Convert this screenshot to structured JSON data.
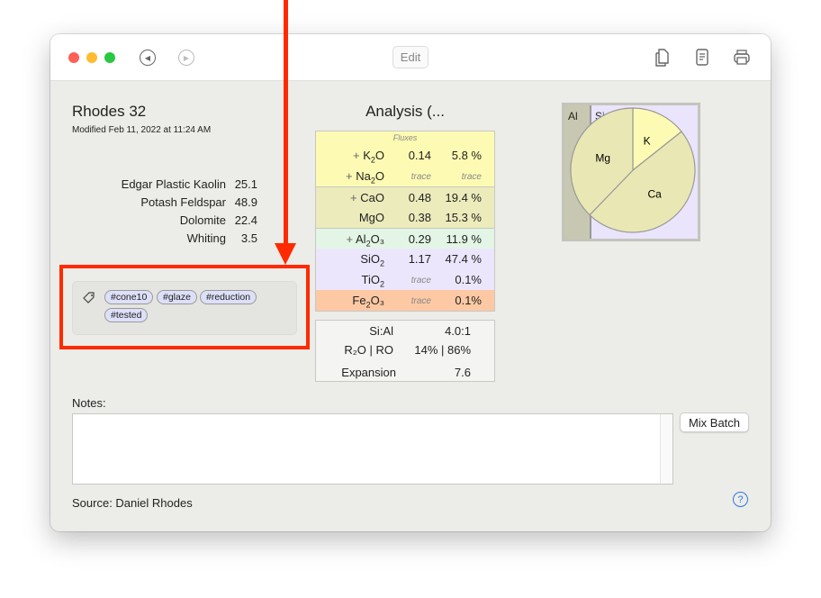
{
  "window": {
    "edit_label": "Edit",
    "toolbar_icons": [
      "duplicate-icon",
      "document-icon",
      "print-icon"
    ]
  },
  "recipe": {
    "title": "Rhodes 32",
    "modified": "Modified Feb 11, 2022 at 11:24 AM",
    "ingredients": [
      {
        "name": "Edgar Plastic Kaolin",
        "amount": "25.1"
      },
      {
        "name": "Potash Feldspar",
        "amount": "48.9"
      },
      {
        "name": "Dolomite",
        "amount": "22.4"
      },
      {
        "name": "Whiting",
        "amount": "3.5"
      }
    ],
    "tags": [
      "#cone10",
      "#glaze",
      "#reduction",
      "#tested"
    ]
  },
  "analysis": {
    "title": "Analysis (...",
    "fluxes_label": "Fluxes",
    "rows": [
      {
        "prefix": "+ ",
        "base": "K",
        "sub": "2",
        "tail": "O",
        "mol": "0.14",
        "pct": "5.8 %",
        "color": "#fdfbb3"
      },
      {
        "prefix": "+ ",
        "base": "Na",
        "sub": "2",
        "tail": "O",
        "mol": "trace",
        "pct": "trace",
        "color": "#fdfbb3"
      },
      {
        "prefix": "+ ",
        "base": "CaO",
        "sub": "",
        "tail": "",
        "mol": "0.48",
        "pct": "19.4 %",
        "color": "#ecebbb"
      },
      {
        "prefix": "",
        "base": "MgO",
        "sub": "",
        "tail": "",
        "mol": "0.38",
        "pct": "15.3 %",
        "color": "#ecebbb"
      },
      {
        "prefix": "+ ",
        "base": "Al",
        "sub": "2",
        "tail": "O₃",
        "mol": "0.29",
        "pct": "11.9 %",
        "color": "#e3f5e4"
      },
      {
        "prefix": "",
        "base": "SiO",
        "sub": "2",
        "tail": "",
        "mol": "1.17",
        "pct": "47.4 %",
        "color": "#ece6fd"
      },
      {
        "prefix": "",
        "base": "TiO",
        "sub": "2",
        "tail": "",
        "mol": "trace",
        "pct": "0.1%",
        "color": "#ece6fd"
      },
      {
        "prefix": "",
        "base": "Fe",
        "sub": "2",
        "tail": "O₃",
        "mol": "trace",
        "pct": "0.1%",
        "color": "#fdc9a4"
      }
    ],
    "stats": {
      "si_al_label": "Si:Al",
      "si_al": "4.0:1",
      "r2o_ro_label": "R₂O | RO",
      "r2o_ro": "14% | 86%",
      "expansion_label": "Expansion",
      "expansion": "7.6"
    },
    "pie": {
      "al_label": "Al",
      "si_label": "Si",
      "al_fraction": 0.2,
      "slices": [
        {
          "label": "K",
          "value": 5.8,
          "color": "#fdfbb3"
        },
        {
          "label": "Ca",
          "value": 19.4,
          "color": "#e9e8b4"
        },
        {
          "label": "Mg",
          "value": 15.3,
          "color": "#e9e8b4"
        }
      ]
    }
  },
  "notes": {
    "label": "Notes:",
    "value": ""
  },
  "mix_batch_label": "Mix Batch",
  "source": "Source: Daniel Rhodes",
  "help_label": "?"
}
